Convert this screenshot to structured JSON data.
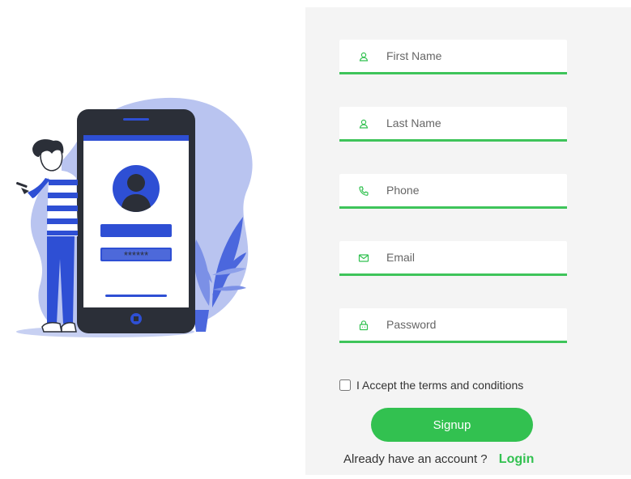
{
  "form": {
    "first_name": {
      "placeholder": "First Name",
      "value": ""
    },
    "last_name": {
      "placeholder": "Last Name",
      "value": ""
    },
    "phone": {
      "placeholder": "Phone",
      "value": ""
    },
    "email": {
      "placeholder": "Email",
      "value": ""
    },
    "password": {
      "placeholder": "Password",
      "value": ""
    },
    "terms_label": "I Accept the terms and conditions",
    "signup_label": "Signup",
    "already_text": "Already have an account ?",
    "login_label": "Login",
    "password_dots": "******"
  },
  "colors": {
    "accent": "#32c150",
    "panel_bg": "#f4f4f4",
    "illustration_blue": "#2e4fd4",
    "illustration_light": "#b9c4f0",
    "phone_dark": "#2b2f38"
  },
  "icons": {
    "first_name": "user-icon",
    "last_name": "user-icon",
    "phone": "phone-icon",
    "email": "envelope-icon",
    "password": "lock-icon"
  }
}
